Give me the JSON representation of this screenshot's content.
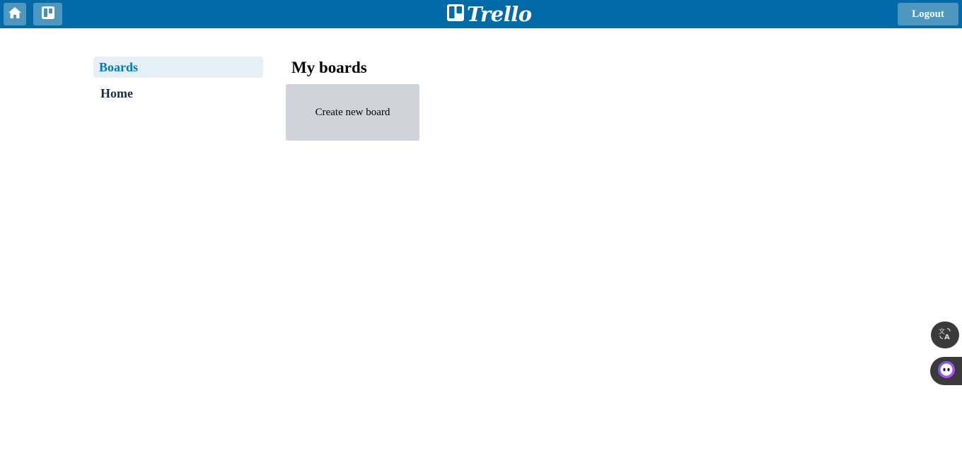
{
  "header": {
    "logo_text": "Trello",
    "logout_label": "Logout",
    "home_icon": "home-icon",
    "boards_icon": "boards-icon"
  },
  "sidebar": {
    "items": [
      {
        "label": "Boards",
        "active": true
      },
      {
        "label": "Home",
        "active": false
      }
    ]
  },
  "main": {
    "title": "My boards",
    "create_board_label": "Create new board"
  },
  "floating": {
    "translate_icon": "translate-icon",
    "assistant_icon": "assistant-icon"
  },
  "colors": {
    "header_bg": "#026aa7",
    "active_text": "#0079bf",
    "active_bg": "#e4f0f6",
    "tile_bg": "#d0d4da"
  }
}
